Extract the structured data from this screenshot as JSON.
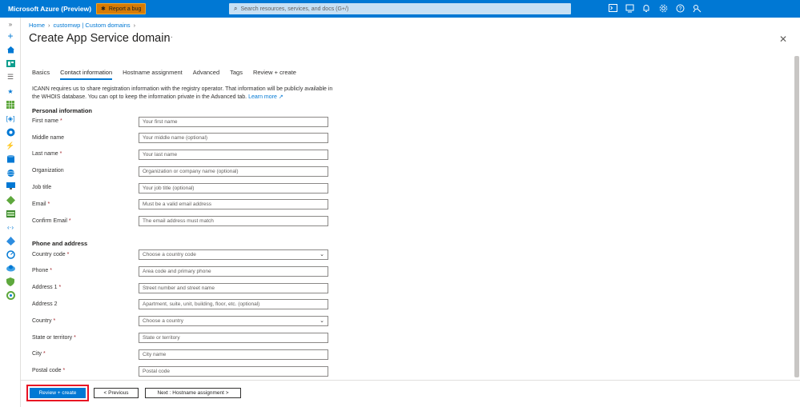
{
  "topbar": {
    "brand": "Microsoft Azure (Preview)",
    "report_bug": "Report a bug",
    "search_placeholder": "Search resources, services, and docs (G+/)",
    "icons": [
      "cloud-shell-icon",
      "directory-filter-icon",
      "notifications-icon",
      "settings-icon",
      "help-icon",
      "feedback-icon"
    ]
  },
  "rail": {
    "icons": [
      "expand-icon",
      "create-resource-icon",
      "home-icon",
      "dashboard-icon",
      "all-services-icon",
      "favorites-icon",
      "all-resources-icon",
      "resource-groups-icon",
      "app-services-icon",
      "function-apps-icon",
      "sql-databases-icon",
      "cosmos-db-icon",
      "virtual-machines-icon",
      "load-balancers-icon",
      "storage-accounts-icon",
      "virtual-networks-icon",
      "entra-id-icon",
      "monitor-icon",
      "advisor-icon",
      "defender-icon",
      "cost-management-icon"
    ]
  },
  "breadcrumb": [
    "Home",
    "customwp | Custom domains"
  ],
  "page": {
    "title": "Create App Service domain",
    "more": "···",
    "close": "✕"
  },
  "tabs": [
    {
      "label": "Basics",
      "active": false
    },
    {
      "label": "Contact information",
      "active": true
    },
    {
      "label": "Hostname assignment",
      "active": false
    },
    {
      "label": "Advanced",
      "active": false
    },
    {
      "label": "Tags",
      "active": false
    },
    {
      "label": "Review + create",
      "active": false
    }
  ],
  "intro": {
    "text": "ICANN requires us to share registration information with the registry operator. That information will be publicly available in the WHOIS database. You can opt to keep the information private in the Advanced tab.",
    "link": "Learn more"
  },
  "personal": {
    "heading": "Personal information",
    "fields": [
      {
        "label": "First name",
        "required": "*",
        "placeholder": "Your first name"
      },
      {
        "label": "Middle name",
        "required": "",
        "placeholder": "Your middle name (optional)"
      },
      {
        "label": "Last name",
        "required": "*",
        "placeholder": "Your last name"
      },
      {
        "label": "Organization",
        "required": "",
        "placeholder": "Organization or company name (optional)"
      },
      {
        "label": "Job title",
        "required": "",
        "placeholder": "Your job title (optional)"
      },
      {
        "label": "Email",
        "required": "*",
        "placeholder": "Must be a valid email address"
      },
      {
        "label": "Confirm Email",
        "required": "*",
        "placeholder": "The email address must match"
      }
    ]
  },
  "phone_address": {
    "heading": "Phone and address",
    "fields": [
      {
        "label": "Country code",
        "required": "*",
        "placeholder": "Choose a country code",
        "type": "select"
      },
      {
        "label": "Phone",
        "required": "*",
        "placeholder": "Area code and primary phone",
        "type": "input"
      },
      {
        "label": "Address 1",
        "required": "*",
        "placeholder": "Street number and street name",
        "type": "input"
      },
      {
        "label": "Address 2",
        "required": "",
        "placeholder": "Apartment, suite, unit, building, floor, etc. (optional)",
        "type": "input"
      },
      {
        "label": "Country",
        "required": "*",
        "placeholder": "Choose a country",
        "type": "select"
      },
      {
        "label": "State or territory",
        "required": "*",
        "placeholder": "State or territory",
        "type": "input"
      },
      {
        "label": "City",
        "required": "*",
        "placeholder": "City name",
        "type": "input"
      },
      {
        "label": "Postal code",
        "required": "*",
        "placeholder": "Postal code",
        "type": "input"
      }
    ]
  },
  "footer": {
    "review_create": "Review + create",
    "previous": "< Previous",
    "next": "Next : Hostname assignment >"
  },
  "colors": {
    "accent": "#0078d4",
    "required": "#a4262c",
    "highlight": "#e81123",
    "bug_button": "#d67b06"
  }
}
